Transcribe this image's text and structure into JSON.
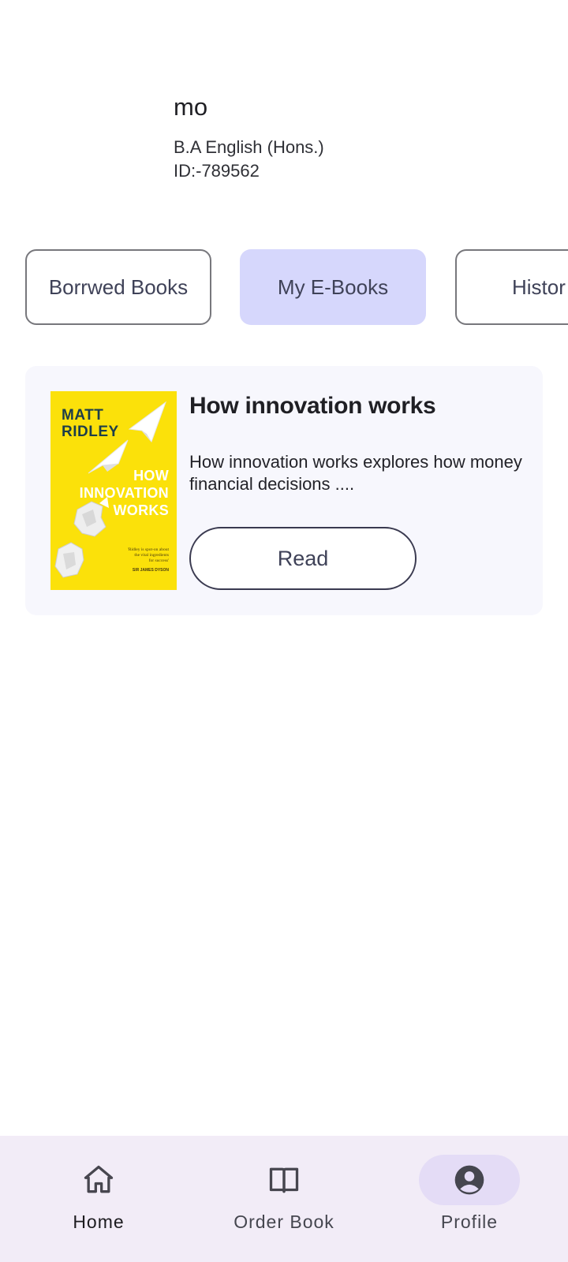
{
  "profile": {
    "name": "mo",
    "course": "B.A English (Hons.)",
    "id": "ID:-789562"
  },
  "tabs": [
    {
      "label": "Borrwed Books",
      "selected": false
    },
    {
      "label": "My E-Books",
      "selected": true
    },
    {
      "label": "Histor",
      "selected": false
    }
  ],
  "books": [
    {
      "title": "How innovation works",
      "description": "How innovation works explores how money financial decisions ....",
      "read_label": "Read",
      "cover": {
        "author_line1": "MATT",
        "author_line2": "RIDLEY",
        "title_line1": "HOW",
        "title_line2": "INNOVATION",
        "title_line3": "WORKS",
        "quote_line1": "'Ridley is spot-on about",
        "quote_line2": "the vital ingredients",
        "quote_line3": "for success'",
        "quote_author": "SIR JAMES DYSON",
        "background_color": "#fbe10a"
      }
    }
  ],
  "bottom_nav": [
    {
      "label": "Home",
      "icon": "home-icon",
      "active": false
    },
    {
      "label": "Order Book",
      "icon": "book-open-icon",
      "active": false
    },
    {
      "label": "Profile",
      "icon": "account-circle-icon",
      "active": true
    }
  ],
  "colors": {
    "selected_tab": "#d6d7fc",
    "card_background": "#f7f7fd",
    "nav_background": "#f2ecf7",
    "nav_active_pill": "#e4dcf6"
  }
}
